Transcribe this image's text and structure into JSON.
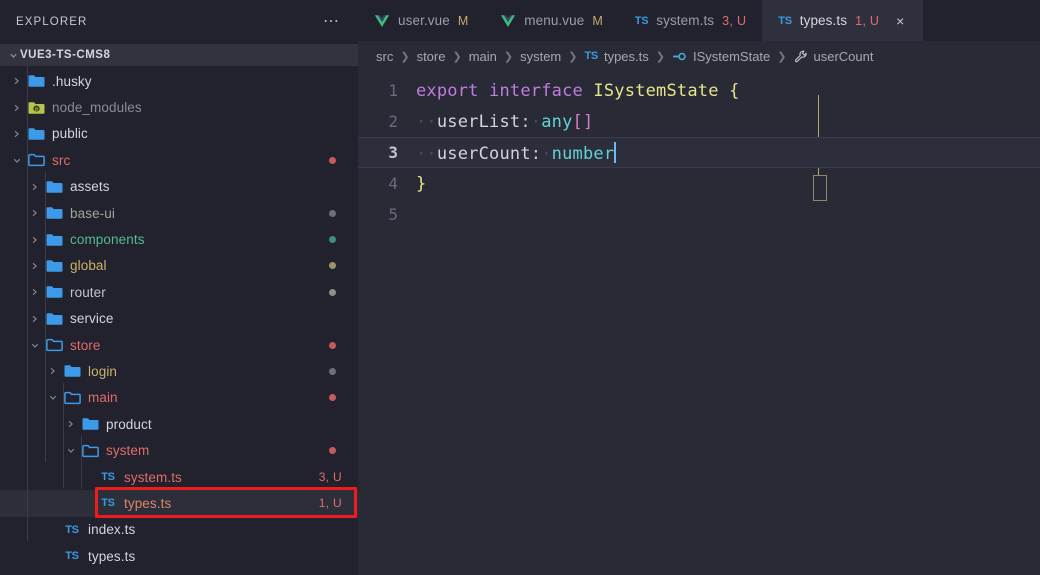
{
  "sidebar": {
    "header_title": "EXPLORER",
    "overflow_icon": "ellipsis-icon",
    "root_label": "VUE3-TS-CMS8",
    "items": [
      {
        "label": ".husky",
        "kind": "folder",
        "depth": 0,
        "expanded": false,
        "color": "#d4d4dc",
        "icon": "folder-blue-icon",
        "badge": "",
        "dot": ""
      },
      {
        "label": "node_modules",
        "kind": "folder",
        "depth": 0,
        "expanded": false,
        "color": "#8b8b96",
        "icon": "folder-node-icon",
        "badge": "",
        "dot": ""
      },
      {
        "label": "public",
        "kind": "folder",
        "depth": 0,
        "expanded": false,
        "color": "#d4d4dc",
        "icon": "folder-blue-icon",
        "badge": "",
        "dot": ""
      },
      {
        "label": "src",
        "kind": "folder",
        "depth": 0,
        "expanded": true,
        "color": "#e06c6c",
        "icon": "folder-open-icon",
        "badge": "",
        "dot": "#c65b5b"
      },
      {
        "label": "assets",
        "kind": "folder",
        "depth": 1,
        "expanded": false,
        "color": "#d4d4dc",
        "icon": "folder-blue-icon",
        "badge": "",
        "dot": ""
      },
      {
        "label": "base-ui",
        "kind": "folder",
        "depth": 1,
        "expanded": false,
        "color": "#9aa89a",
        "icon": "folder-blue-icon",
        "badge": "",
        "dot": "#6d6f7a"
      },
      {
        "label": "components",
        "kind": "folder",
        "depth": 1,
        "expanded": false,
        "color": "#54b98c",
        "icon": "folder-blue-icon",
        "badge": "",
        "dot": "#3f8f78"
      },
      {
        "label": "global",
        "kind": "folder",
        "depth": 1,
        "expanded": false,
        "color": "#cbb36a",
        "icon": "folder-blue-icon",
        "badge": "",
        "dot": "#9d946a"
      },
      {
        "label": "router",
        "kind": "folder",
        "depth": 1,
        "expanded": false,
        "color": "#c3c4c8",
        "icon": "folder-blue-icon",
        "badge": "",
        "dot": "#8e8f86"
      },
      {
        "label": "service",
        "kind": "folder",
        "depth": 1,
        "expanded": false,
        "color": "#d4d4dc",
        "icon": "folder-blue-icon",
        "badge": "",
        "dot": ""
      },
      {
        "label": "store",
        "kind": "folder",
        "depth": 1,
        "expanded": true,
        "color": "#e06c6c",
        "icon": "folder-open-icon",
        "badge": "",
        "dot": "#c65b5b"
      },
      {
        "label": "login",
        "kind": "folder",
        "depth": 2,
        "expanded": false,
        "color": "#cbb36a",
        "icon": "folder-blue-icon",
        "badge": "",
        "dot": "#6d6f7a"
      },
      {
        "label": "main",
        "kind": "folder",
        "depth": 2,
        "expanded": true,
        "color": "#e06c6c",
        "icon": "folder-open-icon",
        "badge": "",
        "dot": "#c65b5b"
      },
      {
        "label": "product",
        "kind": "folder",
        "depth": 3,
        "expanded": false,
        "color": "#d4d4dc",
        "icon": "folder-blue-icon",
        "badge": "",
        "dot": ""
      },
      {
        "label": "system",
        "kind": "folder",
        "depth": 3,
        "expanded": true,
        "color": "#e06c6c",
        "icon": "folder-open-icon",
        "badge": "",
        "dot": "#c65b5b"
      },
      {
        "label": "system.ts",
        "kind": "file",
        "depth": 4,
        "expanded": false,
        "color": "#e06c6c",
        "icon": "ts-file-icon",
        "badge": "3, U",
        "dot": ""
      },
      {
        "label": "types.ts",
        "kind": "file",
        "depth": 4,
        "expanded": false,
        "color": "#e0846c",
        "icon": "ts-file-icon",
        "badge": "1, U",
        "dot": "",
        "selected": true,
        "annotated": true
      },
      {
        "label": "index.ts",
        "kind": "file",
        "depth": 2,
        "expanded": false,
        "color": "#d4d4dc",
        "icon": "ts-file-icon",
        "badge": "",
        "dot": ""
      },
      {
        "label": "types.ts",
        "kind": "file",
        "depth": 2,
        "expanded": false,
        "color": "#d4d4dc",
        "icon": "ts-file-icon",
        "badge": "",
        "dot": ""
      }
    ]
  },
  "tabs": [
    {
      "name": "user.vue",
      "icon": "vue-file-icon",
      "status": "M",
      "status_kind": "modified",
      "active": false,
      "closable": false
    },
    {
      "name": "menu.vue",
      "icon": "vue-file-icon",
      "status": "M",
      "status_kind": "modified",
      "active": false,
      "closable": false
    },
    {
      "name": "system.ts",
      "icon": "ts-file-icon",
      "status": "3, U",
      "status_kind": "error",
      "active": false,
      "closable": false
    },
    {
      "name": "types.ts",
      "icon": "ts-file-icon",
      "status": "1, U",
      "status_kind": "error",
      "active": true,
      "closable": true,
      "close_icon": "close-icon"
    }
  ],
  "breadcrumb": [
    {
      "label": "src",
      "icon": ""
    },
    {
      "label": "store",
      "icon": ""
    },
    {
      "label": "main",
      "icon": ""
    },
    {
      "label": "system",
      "icon": ""
    },
    {
      "label": "types.ts",
      "icon": "ts-file-icon"
    },
    {
      "label": "ISystemState",
      "icon": "interface-icon"
    },
    {
      "label": "userCount",
      "icon": "property-wrench-icon"
    }
  ],
  "editor": {
    "lines": [
      {
        "num": "1",
        "active": false
      },
      {
        "num": "2",
        "active": false
      },
      {
        "num": "3",
        "active": true
      },
      {
        "num": "4",
        "active": false
      },
      {
        "num": "5",
        "active": false
      }
    ],
    "code": {
      "l1_kw1": "export",
      "l1_kw2": "interface",
      "l1_type": "ISystemState",
      "l1_brace": "{",
      "l2_prop": "userList",
      "l2_colon": ":",
      "l2_type": "any",
      "l2_brackets": "[]",
      "l3_prop": "userCount",
      "l3_colon": ":",
      "l3_type": "number",
      "l4_brace": "}"
    }
  },
  "colors": {
    "accent_blue": "#3a9ae0",
    "error_red": "#e06c6c",
    "annotation_red": "#f01b1b",
    "keyword_purple": "#c07ce0",
    "type_yellow": "#e8e58a",
    "type_cyan": "#63d0d8",
    "editor_bg": "#282a36",
    "sidebar_bg": "#21222d"
  }
}
